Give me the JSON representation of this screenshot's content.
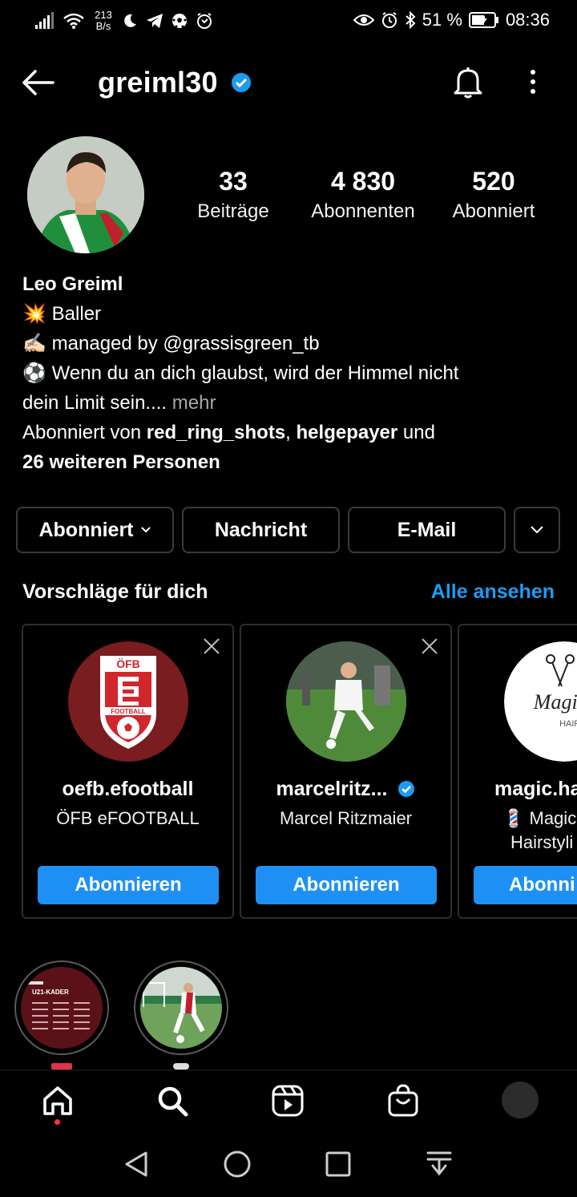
{
  "status_bar": {
    "speed_top": "213",
    "speed_bottom": "B/s",
    "battery_pct": "51 %",
    "time": "08:36",
    "icons": [
      "signal-icon",
      "wifi-icon",
      "moon-icon",
      "telegram-icon",
      "soccer-ball-icon",
      "alarm-icon",
      "eye-icon",
      "clock-icon",
      "bluetooth-icon",
      "battery-icon"
    ]
  },
  "header": {
    "username": "greiml30",
    "verified": true
  },
  "profile": {
    "stats": [
      {
        "value": "33",
        "label": "Beiträge"
      },
      {
        "value": "4 830",
        "label": "Abonnenten"
      },
      {
        "value": "520",
        "label": "Abonniert"
      }
    ],
    "name": "Leo Greiml",
    "bio_lines": [
      {
        "emoji": "💥",
        "text": "Baller"
      },
      {
        "emoji": "✍🏻",
        "text": "managed by @grassisgreen_tb"
      },
      {
        "emoji": "⚽",
        "text": "Wenn du an dich glaubst, wird der Himmel nicht"
      }
    ],
    "bio_continuation": "dein Limit sein....",
    "bio_more": "mehr",
    "followed_by_prefix": "Abonniert von",
    "followed_by_1": "red_ring_shots",
    "followed_by_sep": ",",
    "followed_by_2": "helgepayer",
    "followed_by_and": "und",
    "followed_by_more": "26 weiteren Personen"
  },
  "actions": {
    "following_label": "Abonniert",
    "message_label": "Nachricht",
    "email_label": "E-Mail"
  },
  "suggestions": {
    "title": "Vorschläge für dich",
    "see_all": "Alle ansehen",
    "cards": [
      {
        "username": "oefb.efootball",
        "fullname": "ÖFB eFOOTBALL",
        "fullname2": "",
        "button": "Abonnieren",
        "verified": false,
        "logo_text_top": "ÖFB",
        "logo_text_band": "FOOTBALL"
      },
      {
        "username": "marcelritz...",
        "fullname": "Marcel Ritzmaier",
        "fullname2": "",
        "button": "Abonnieren",
        "verified": true
      },
      {
        "username": "magic.ha",
        "fullname": "💈 Magic",
        "fullname2": "Hairstyli",
        "button": "Abonni",
        "verified": false,
        "logo_text_top": "Magic",
        "logo_text_bottom": "HAIRSTYL"
      }
    ]
  },
  "highlights": [
    {
      "name": "highlight-u21-kader",
      "badge_text": "U21-KADER"
    },
    {
      "name": "highlight-match"
    }
  ],
  "bottom_nav": [
    "home-icon",
    "search-icon",
    "reels-icon",
    "shop-icon",
    "profile-avatar"
  ],
  "system_nav": [
    "back-triangle-icon",
    "home-circle-icon",
    "recents-square-icon",
    "notification-pull-icon"
  ],
  "colors": {
    "accent": "#1d9bf0",
    "button_blue": "#1e90f5",
    "border": "#3a3a3a",
    "bg": "#000000"
  }
}
